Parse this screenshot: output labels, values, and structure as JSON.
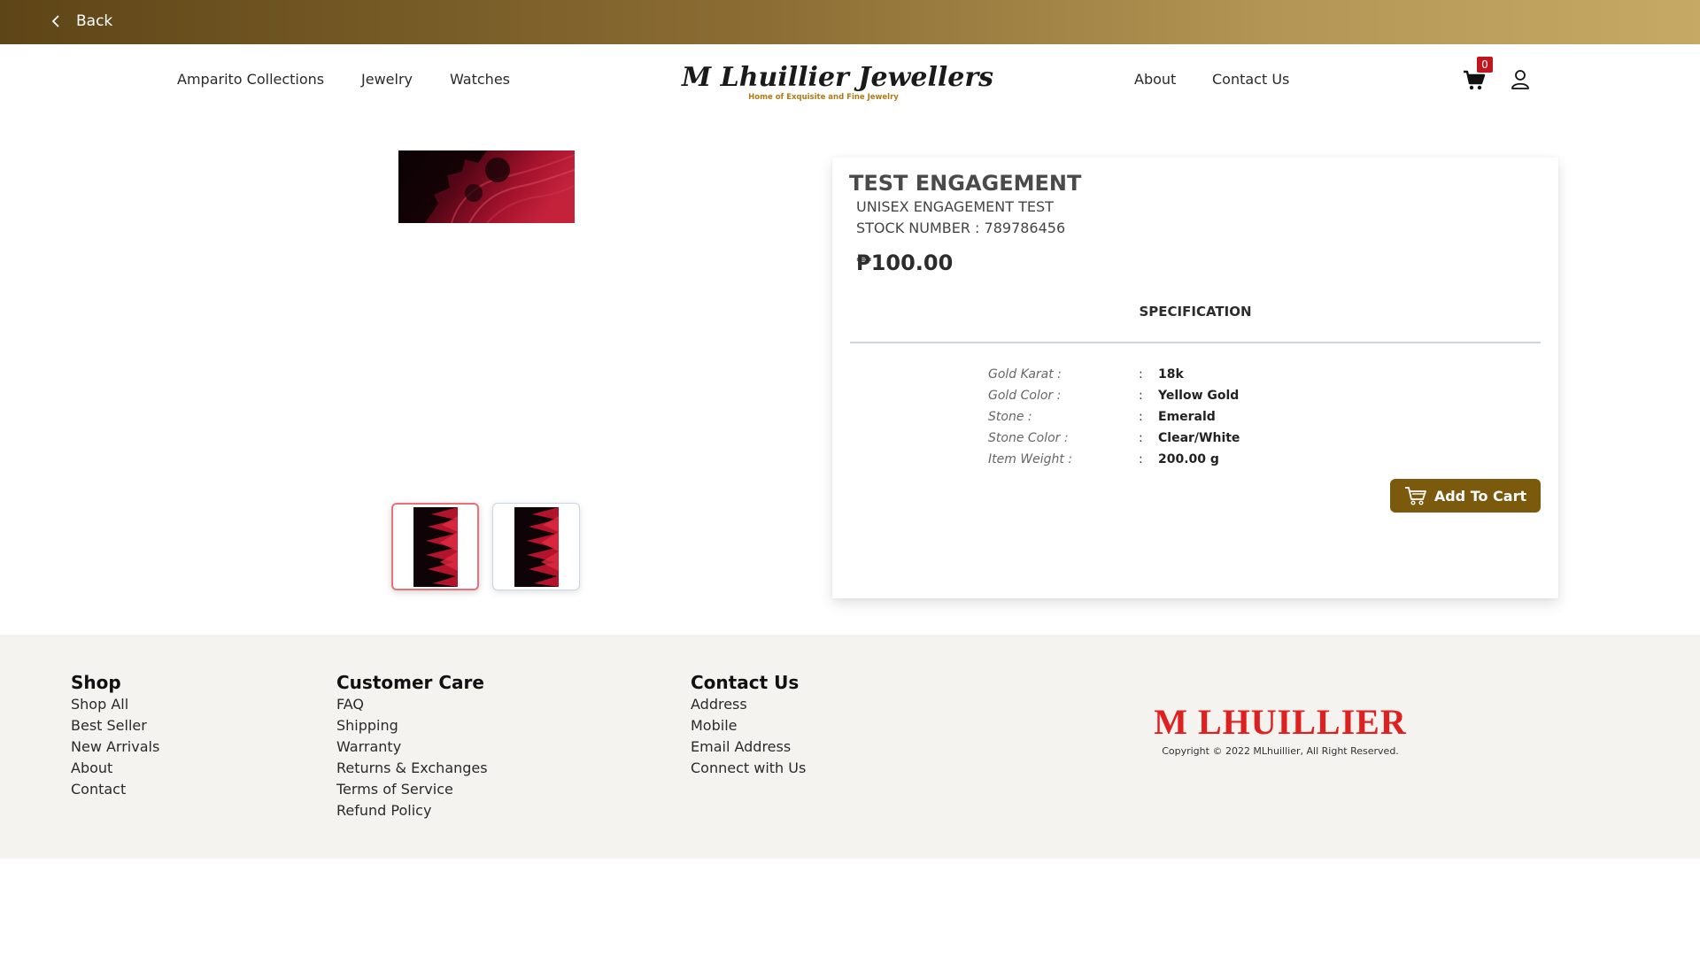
{
  "topbar": {
    "back_label": "Back"
  },
  "nav": {
    "left": [
      "Amparito Collections",
      "Jewelry",
      "Watches"
    ],
    "right": [
      "About",
      "Contact Us"
    ],
    "cart_count": "0"
  },
  "logo": {
    "name": "M Lhuillier Jewellers",
    "tagline": "Home of Exquisite and Fine Jewelry"
  },
  "product": {
    "title": "TEST ENGAGEMENT",
    "subtitle": "UNISEX ENGAGEMENT TEST",
    "stock": "STOCK NUMBER : 789786456",
    "price": "₱100.00",
    "spec_heading": "SPECIFICATION",
    "specs": [
      {
        "label": "Gold Karat :",
        "value": "18k"
      },
      {
        "label": "Gold Color :",
        "value": "Yellow Gold"
      },
      {
        "label": "Stone :",
        "value": "Emerald"
      },
      {
        "label": "Stone Color :",
        "value": "Clear/White"
      },
      {
        "label": "Item Weight :",
        "value": "200.00 g"
      }
    ],
    "add_to_cart": "Add To Cart"
  },
  "footer": {
    "shop": {
      "heading": "Shop",
      "links": [
        "Shop All",
        "Best Seller",
        "New Arrivals",
        "About",
        "Contact"
      ]
    },
    "care": {
      "heading": "Customer Care",
      "links": [
        "FAQ",
        "Shipping",
        "Warranty",
        "Returns & Exchanges",
        "Terms of Service",
        "Refund Policy"
      ]
    },
    "contact": {
      "heading": "Contact Us",
      "links": [
        "Address",
        "Mobile",
        "Email Address",
        "Connect with Us"
      ]
    },
    "brand": "M LHUILLIER",
    "copyright": "Copyright © 2022 MLhuillier, All Right Reserved."
  },
  "colors": {
    "accent": "#7c5a0d",
    "brand_red": "#e0201f",
    "badge": "#c0171f",
    "footer_bg": "#f4f3ef"
  }
}
